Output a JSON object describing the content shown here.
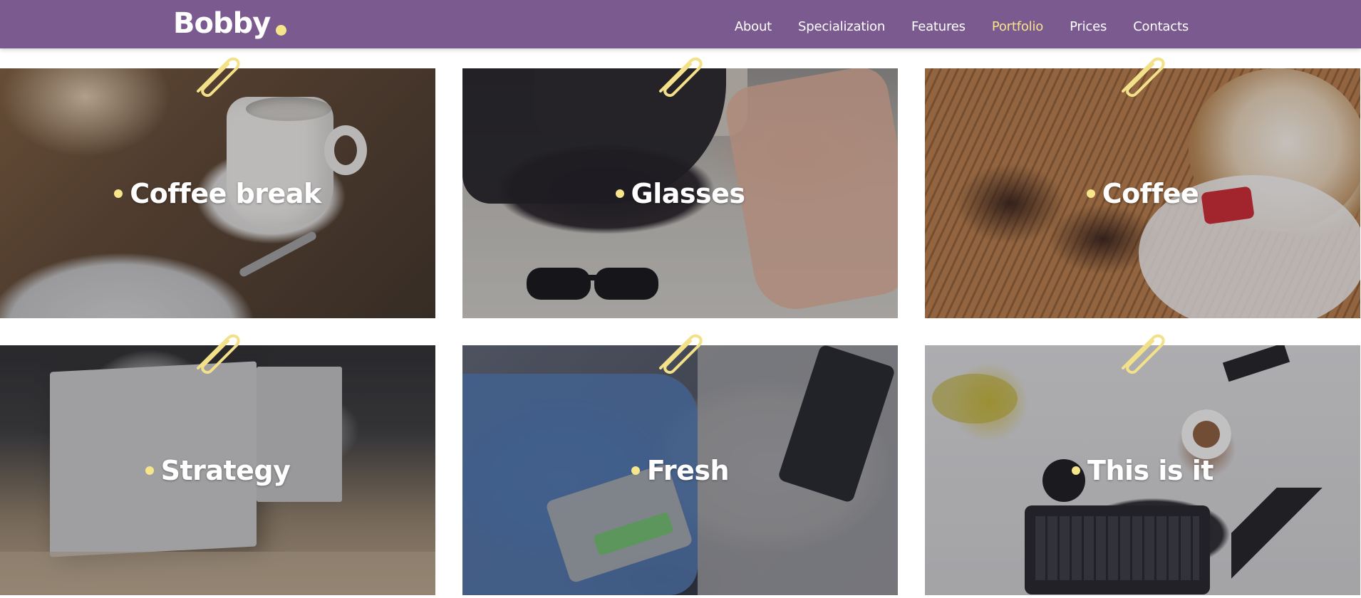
{
  "header": {
    "logo_text": "Bobby",
    "nav": [
      {
        "label": "About",
        "active": false
      },
      {
        "label": "Specialization",
        "active": false
      },
      {
        "label": "Features",
        "active": false
      },
      {
        "label": "Portfolio",
        "active": true
      },
      {
        "label": "Prices",
        "active": false
      },
      {
        "label": "Contacts",
        "active": false
      }
    ]
  },
  "portfolio": {
    "items": [
      {
        "title": "Coffee break",
        "photo": "coffee-break-photo"
      },
      {
        "title": "Glasses",
        "photo": "glasses-photo"
      },
      {
        "title": "Coffee",
        "photo": "coffee-photo"
      },
      {
        "title": "Strategy",
        "photo": "strategy-photo"
      },
      {
        "title": "Fresh",
        "photo": "fresh-photo"
      },
      {
        "title": "This is it",
        "photo": "this-is-it-photo"
      }
    ]
  },
  "colors": {
    "header_bg": "#7b5a8f",
    "accent": "#f7e38a",
    "dot": "#f6e58a",
    "text": "#ffffff"
  },
  "icons": {
    "paperclip": "paperclip-icon",
    "bullet": "bullet-dot-icon"
  }
}
